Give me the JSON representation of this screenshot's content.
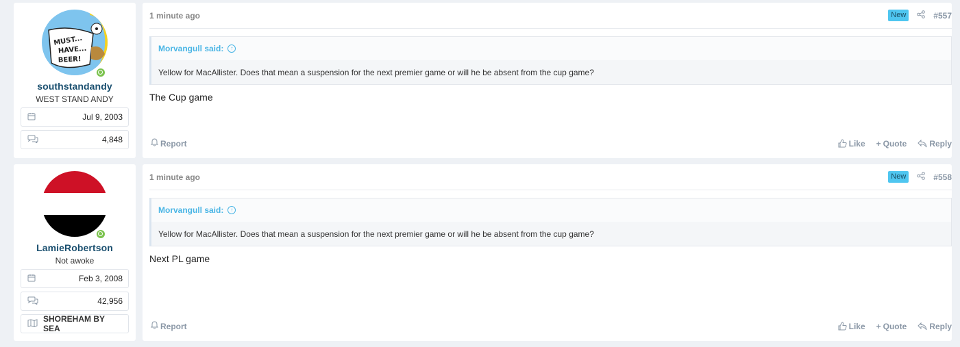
{
  "posts": [
    {
      "username": "southstandandy",
      "user_title": "WEST STAND ANDY",
      "joined": "Jul 9, 2003",
      "messages": "4,848",
      "avatar_text": "MUST... HAVE... BEER!",
      "time": "1 minute ago",
      "badge": "New",
      "post_number": "#557",
      "quote_author": "Morvangull said:",
      "quote_text": "Yellow for MacAllister. Does that mean a suspension for the next premier game or will he be absent from the cup game?",
      "message": "The Cup game",
      "report": "Report",
      "like": "Like",
      "quote_btn": "Quote",
      "reply": "Reply"
    },
    {
      "username": "LamieRobertson",
      "user_title": "Not awoke",
      "joined": "Feb 3, 2008",
      "messages": "42,956",
      "location": "SHOREHAM BY SEA",
      "time": "1 minute ago",
      "badge": "New",
      "post_number": "#558",
      "quote_author": "Morvangull said:",
      "quote_text": "Yellow for MacAllister. Does that mean a suspension for the next premier game or will he be absent from the cup game?",
      "message": "Next PL game",
      "report": "Report",
      "like": "Like",
      "quote_btn": "Quote",
      "reply": "Reply"
    }
  ],
  "colors": {
    "accent": "#49b5e5",
    "username": "#1a4f6f",
    "online": "#7cc34f",
    "badge": "#4fc6f0"
  }
}
